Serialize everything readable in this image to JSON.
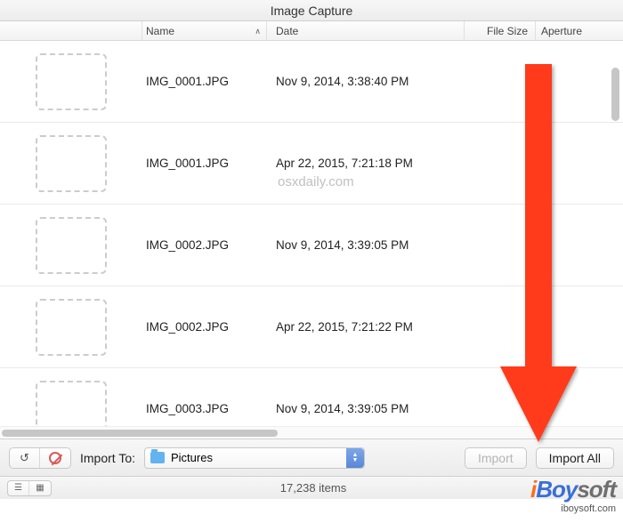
{
  "window": {
    "title": "Image Capture"
  },
  "columns": {
    "name": "Name",
    "date": "Date",
    "file_size": "File Size",
    "aperture": "Aperture"
  },
  "rows": [
    {
      "name": "IMG_0001.JPG",
      "date": "Nov 9, 2014, 3:38:40 PM"
    },
    {
      "name": "IMG_0001.JPG",
      "date": "Apr 22, 2015, 7:21:18 PM"
    },
    {
      "name": "IMG_0002.JPG",
      "date": "Nov 9, 2014, 3:39:05 PM"
    },
    {
      "name": "IMG_0002.JPG",
      "date": "Apr 22, 2015, 7:21:22 PM"
    },
    {
      "name": "IMG_0003.JPG",
      "date": "Nov 9, 2014, 3:39:05 PM"
    }
  ],
  "source_watermark": "osxdaily.com",
  "toolbar": {
    "import_to_label": "Import To:",
    "destination": "Pictures",
    "import_button": "Import",
    "import_all_button": "Import All"
  },
  "status": {
    "item_count": "17,238 items"
  },
  "brand": {
    "i": "i",
    "boy": "Boy",
    "soft": "soft",
    "domain": "iboysoft.com"
  }
}
